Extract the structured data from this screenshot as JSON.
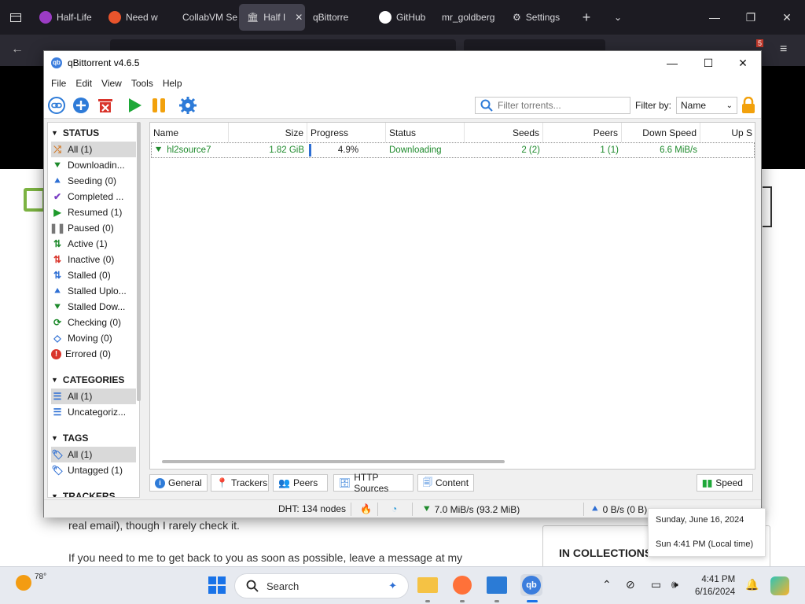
{
  "browser": {
    "tabs": [
      {
        "label": "Half-Life",
        "color": "#9b3cc4"
      },
      {
        "label": "Need w",
        "color": "#e8542c"
      },
      {
        "label": "CollabVM Se",
        "color": "#2b2a33"
      },
      {
        "label": "Half I",
        "color": "#cfcfcf"
      },
      {
        "label": "qBittorre",
        "color": "#2b2a33"
      },
      {
        "label": "GitHub",
        "color": "#ffffff"
      },
      {
        "label": "mr_goldberg",
        "color": "#2b2a33"
      },
      {
        "label": "Settings",
        "color": "#cfcfcf"
      }
    ],
    "badge_count": "5"
  },
  "webpage": {
    "para1": "real email), though I rarely check it.",
    "para2": "If you need to me to get back to you as soon as possible, leave a message at my",
    "collections_label": "IN COLLECTIONS"
  },
  "calendar_popup": {
    "date_line": "Sunday, June 16, 2024",
    "time_line": "Sun 4:41 PM (Local time)"
  },
  "qb": {
    "title": "qBittorrent v4.6.5",
    "menu": [
      "File",
      "Edit",
      "View",
      "Tools",
      "Help"
    ],
    "filter_placeholder": "Filter torrents...",
    "filter_by_label": "Filter by:",
    "filter_by_value": "Name",
    "status_header": "STATUS",
    "status_items": [
      {
        "label": "All (1)",
        "icon": "shuffle-icon",
        "color": "#d37b2a",
        "glyph": "⤮"
      },
      {
        "label": "Downloadin...",
        "icon": "download-chevrons-icon",
        "color": "#1e8a2c",
        "glyph": "⯆"
      },
      {
        "label": "Seeding (0)",
        "icon": "upload-chevrons-icon",
        "color": "#2e6fd4",
        "glyph": "⯅"
      },
      {
        "label": "Completed ...",
        "icon": "check-icon",
        "color": "#7a3fc4",
        "glyph": "✔"
      },
      {
        "label": "Resumed (1)",
        "icon": "play-icon",
        "color": "#1e9a2c",
        "glyph": "▶"
      },
      {
        "label": "Paused (0)",
        "icon": "pause-icon",
        "color": "#777777",
        "glyph": "❚❚"
      },
      {
        "label": "Active (1)",
        "icon": "active-arrows-icon",
        "color": "#1e8a2c",
        "glyph": "⇅"
      },
      {
        "label": "Inactive (0)",
        "icon": "inactive-arrows-icon",
        "color": "#d9342b",
        "glyph": "⇅"
      },
      {
        "label": "Stalled (0)",
        "icon": "stalled-arrows-icon",
        "color": "#2e6fd4",
        "glyph": "⇅"
      },
      {
        "label": "Stalled Uplo...",
        "icon": "stalled-upload-icon",
        "color": "#2e6fd4",
        "glyph": "⯅"
      },
      {
        "label": "Stalled Dow...",
        "icon": "stalled-download-icon",
        "color": "#1e8a2c",
        "glyph": "⯆"
      },
      {
        "label": "Checking (0)",
        "icon": "refresh-icon",
        "color": "#1e8a2c",
        "glyph": "⟳"
      },
      {
        "label": "Moving (0)",
        "icon": "move-icon",
        "color": "#2e6fd4",
        "glyph": "◇"
      },
      {
        "label": "Errored (0)",
        "icon": "error-icon",
        "color": "#d9342b",
        "glyph": "!"
      }
    ],
    "categories_header": "CATEGORIES",
    "category_items": [
      {
        "label": "All (1)"
      },
      {
        "label": "Uncategoriz..."
      }
    ],
    "tags_header": "TAGS",
    "tag_items": [
      {
        "label": "All (1)"
      },
      {
        "label": "Untagged (1)"
      }
    ],
    "trackers_header": "TRACKERS",
    "columns": [
      "Name",
      "Size",
      "Progress",
      "Status",
      "Seeds",
      "Peers",
      "Down Speed",
      "Up S"
    ],
    "torrents": [
      {
        "name": "hl2source7",
        "size": "1.82 GiB",
        "progress_text": "4.9%",
        "progress": 0.049,
        "status": "Downloading",
        "seeds": "2 (2)",
        "peers": "1 (1)",
        "down_speed": "6.6 MiB/s"
      }
    ],
    "bottom_tabs": [
      "General",
      "Trackers",
      "Peers",
      "HTTP Sources",
      "Content"
    ],
    "speed_tab": "Speed",
    "statusbar": {
      "dht": "DHT: 134 nodes",
      "download": "7.0 MiB/s (93.2 MiB)",
      "upload": "0 B/s (0 B)"
    }
  },
  "taskbar": {
    "weather_temp": "78°",
    "search_label": "Search",
    "time": "4:41 PM",
    "date": "6/16/2024"
  }
}
